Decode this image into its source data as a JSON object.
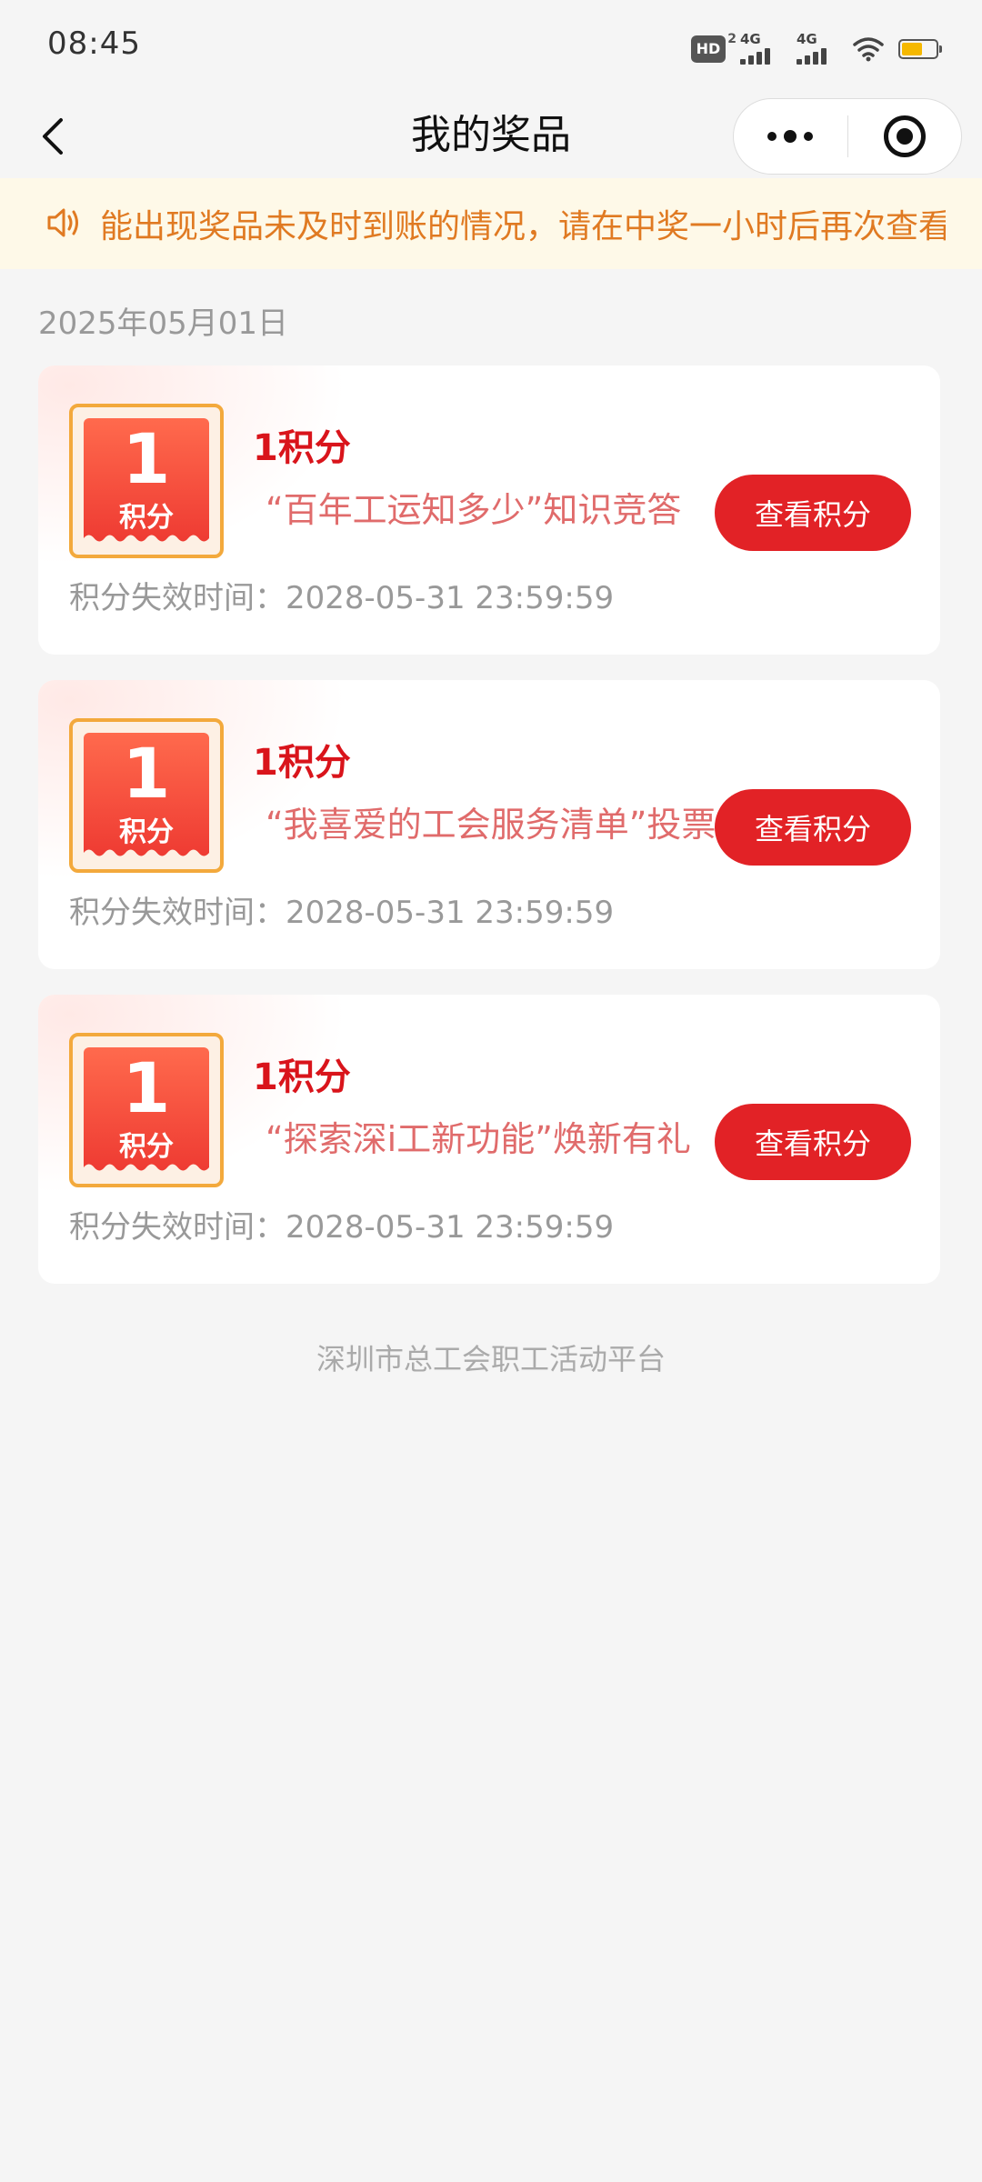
{
  "status_bar": {
    "time": "08:45",
    "hd_label": "HD",
    "hd_sub": "2",
    "signal_1": "4G",
    "signal_2": "4G",
    "battery_level": 0.6,
    "battery_color": "#f5b800"
  },
  "nav": {
    "title": "我的奖品",
    "back_icon": "chevron-left-icon",
    "menu_icon": "more-dots-icon",
    "close_icon": "target-circle-icon"
  },
  "notice": {
    "icon": "speaker-icon",
    "text": "能出现奖品未及时到账的情况，请在中奖一小时后再次查看"
  },
  "date_header": "2025年05月01日",
  "prizes": [
    {
      "coupon_number": "1",
      "coupon_unit": "积分",
      "title": "1积分",
      "description": "“百年工运知多少”知识竞答",
      "button_label": "查看积分",
      "expire_label": "积分失效时间：",
      "expire_time": "2028-05-31 23:59:59"
    },
    {
      "coupon_number": "1",
      "coupon_unit": "积分",
      "title": "1积分",
      "description": "“我喜爱的工会服务清单”投票",
      "button_label": "查看积分",
      "expire_label": "积分失效时间：",
      "expire_time": "2028-05-31 23:59:59"
    },
    {
      "coupon_number": "1",
      "coupon_unit": "积分",
      "title": "1积分",
      "description": "“探索深i工新功能”焕新有礼",
      "button_label": "查看积分",
      "expire_label": "积分失效时间：",
      "expire_time": "2028-05-31 23:59:59"
    }
  ],
  "footer": "深圳市总工会职工活动平台",
  "colors": {
    "accent_red": "#e22226",
    "title_red": "#d9141b",
    "notice_orange": "#e07a22",
    "notice_bg": "#fef9e8",
    "coupon_border": "#f3a93c"
  }
}
